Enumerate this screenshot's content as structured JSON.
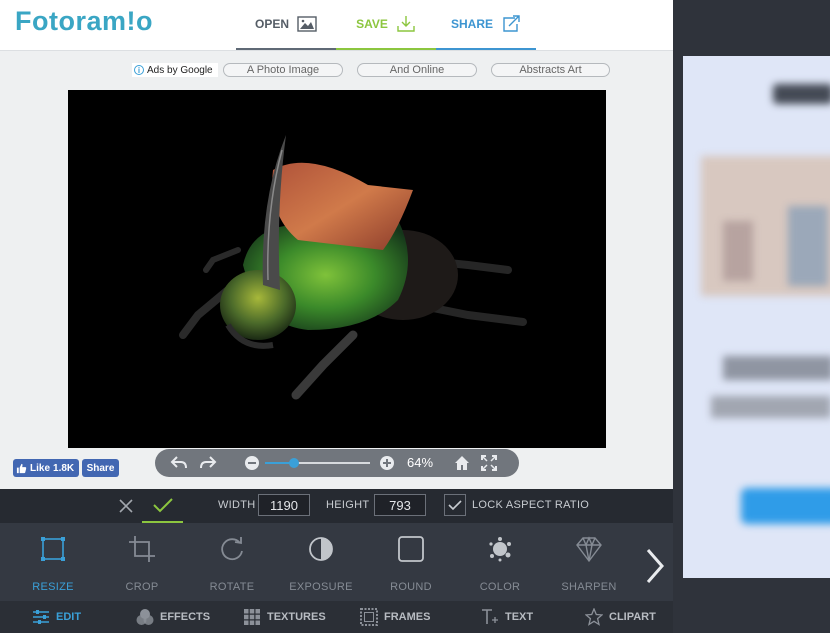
{
  "header": {
    "logo": "Fotoram!o",
    "tabs": [
      {
        "label": "OPEN",
        "icon": "image-icon"
      },
      {
        "label": "SAVE",
        "icon": "download-icon"
      },
      {
        "label": "SHARE",
        "icon": "share-icon"
      }
    ]
  },
  "ads": {
    "ads_by": "Ads by Google",
    "links": [
      "A Photo Image",
      "And Online",
      "Abstracts Art"
    ]
  },
  "zoom": {
    "label": "64%",
    "slider_fraction": 0.28
  },
  "facebook": {
    "like_label": "Like",
    "like_count": "1.8K",
    "share_label": "Share"
  },
  "options": {
    "width_label": "WIDTH",
    "width_value": "1190",
    "height_label": "HEIGHT",
    "height_value": "793",
    "lock_label": "LOCK ASPECT RATIO",
    "lock_checked": true
  },
  "tools": [
    {
      "label": "RESIZE",
      "icon": "resize-icon",
      "active": true
    },
    {
      "label": "CROP",
      "icon": "crop-icon",
      "active": false
    },
    {
      "label": "ROTATE",
      "icon": "rotate-icon",
      "active": false
    },
    {
      "label": "EXPOSURE",
      "icon": "exposure-icon",
      "active": false
    },
    {
      "label": "ROUND",
      "icon": "round-icon",
      "active": false
    },
    {
      "label": "COLOR",
      "icon": "color-icon",
      "active": false
    },
    {
      "label": "SHARPEN",
      "icon": "sharpen-icon",
      "active": false
    }
  ],
  "tabs": [
    {
      "label": "EDIT",
      "icon": "sliders-icon",
      "active": true
    },
    {
      "label": "EFFECTS",
      "icon": "effects-icon",
      "active": false
    },
    {
      "label": "TEXTURES",
      "icon": "textures-icon",
      "active": false
    },
    {
      "label": "FRAMES",
      "icon": "frames-icon",
      "active": false
    },
    {
      "label": "TEXT",
      "icon": "text-icon",
      "active": false
    },
    {
      "label": "CLIPART",
      "icon": "star-icon",
      "active": false
    }
  ],
  "colors": {
    "accent_blue": "#3aa0d8",
    "accent_green": "#8cc63f",
    "logo": "#3aa6c4"
  }
}
